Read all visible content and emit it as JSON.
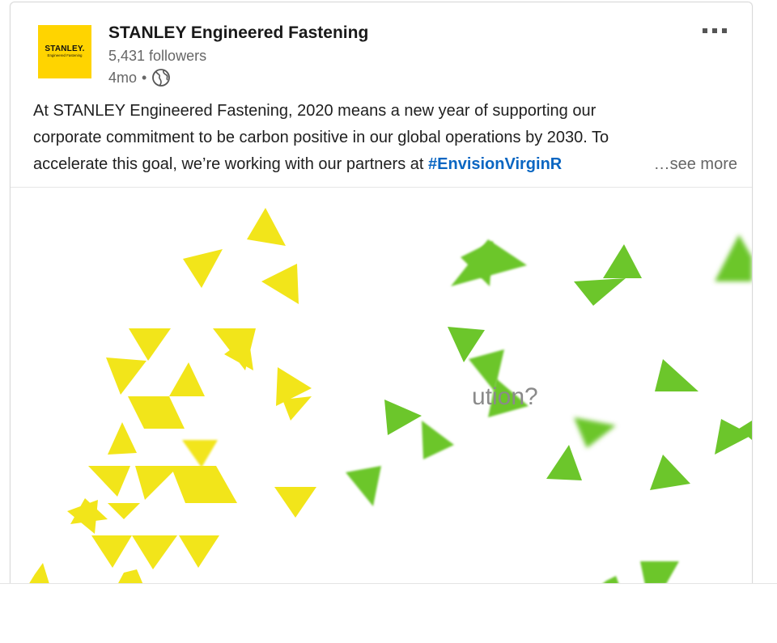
{
  "post": {
    "company_name": "STANLEY Engineered Fastening",
    "followers": "5,431 followers",
    "time_ago": "4mo",
    "separator": "•",
    "visibility_icon": "globe-icon",
    "more_icon": "more-horizontal-icon",
    "logo": {
      "word": "STANLEY.",
      "sub": "Engineered Fastening",
      "background": "#ffd400"
    },
    "text_lines": [
      "At STANLEY Engineered Fastening, 2020 means a new year of supporting our",
      "corporate commitment to be carbon positive in our global operations by 2030. To",
      "accelerate this goal, we’re working with our partners at "
    ],
    "hashtag": "#EnvisionVirginR",
    "see_more": "…see more"
  },
  "media": {
    "overlay_text": "ution?",
    "colors": {
      "yellow": "#f2e51a",
      "green": "#6cc62b"
    }
  },
  "colors": {
    "link": "#0a66c2",
    "secondary_text": "#666666",
    "primary_text": "#191919"
  }
}
